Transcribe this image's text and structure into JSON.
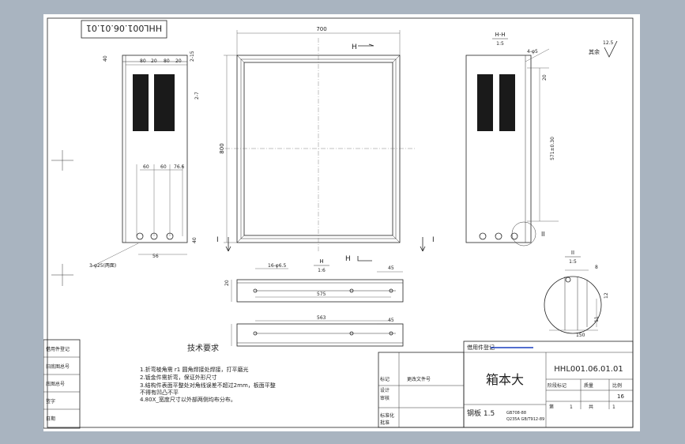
{
  "drawing_number_top": "HHL001.06.01.01",
  "part_name": "箱本大",
  "drawing_number": "HHL001.06.01.01",
  "material": "钢板 1.5",
  "standard_1": "GB708-88",
  "standard_2": "Q235A GB/T912-89",
  "scale": "1:1",
  "quantity": "16",
  "sheet_total": "1",
  "sheet_no": "1",
  "title_labels": {
    "stage": "阶段标记",
    "weight": "质量",
    "scale": "比例",
    "sheet": "第",
    "sheet_unit": "张",
    "total": "共",
    "total_unit": "张",
    "mark": "标记",
    "count": "处数",
    "zone": "分区",
    "change_doc": "更改文件号",
    "sign": "签名",
    "date": "年月日",
    "design": "设计",
    "check": "审核",
    "process": "工艺",
    "standardize": "标准化",
    "approve": "批准",
    "usage": "借用件登记",
    "trace": "描图",
    "base_no": "底图总号",
    "sig_date": "签字日期",
    "old_no": "旧底图总号",
    "used_for": "借(通)用件登记",
    "unit": "用途"
  },
  "tech_title": "技术要求",
  "tech_notes": [
    "1.折弯棱角需 r1 圆角焊接处焊接，打平磨光",
    "2.钣金件需折弯，保证外形尺寸",
    "3.结构件表面平整处对角线误差不超过2mm，板面平整",
    "  不得有凹凸不平",
    "4.80X_宽度尺寸以外部两侧均布分布。"
  ],
  "view_labels": {
    "section_h": "H-H",
    "section_h_scale": "1:5",
    "section_ii": "II",
    "section_ii_scale": "1:5",
    "section_hh_top": "H",
    "section_hh_scale": "1:6",
    "marker_h": "H",
    "marker_i": "I",
    "marker_ii": "II"
  },
  "roughness": "12.5",
  "roughness_label": "其余",
  "dims": {
    "width_700": "700",
    "height_800": "800",
    "d80a": "80",
    "d20a": "20",
    "d80b": "80",
    "d20b": "20",
    "d40": "40",
    "d7": "2-7",
    "d15": "2-15",
    "d40b": "40",
    "d60a": "60",
    "d60b": "60",
    "d766": "76.6",
    "d56": "56",
    "holes_3": "3-φ25(两面)",
    "holes_16": "16-φ6.5",
    "d45a": "45",
    "d45b": "45",
    "d575": "575",
    "d563": "563",
    "d20c": "20",
    "d20d": "20",
    "hole_4": "4-φ5",
    "d571": "571±0.30",
    "d8": "8",
    "d11": "11",
    "d150": "150",
    "d12": "12"
  },
  "left_rail": [
    "借用件登记",
    "旧底图总号",
    "底图总号",
    "签字",
    "日期"
  ]
}
